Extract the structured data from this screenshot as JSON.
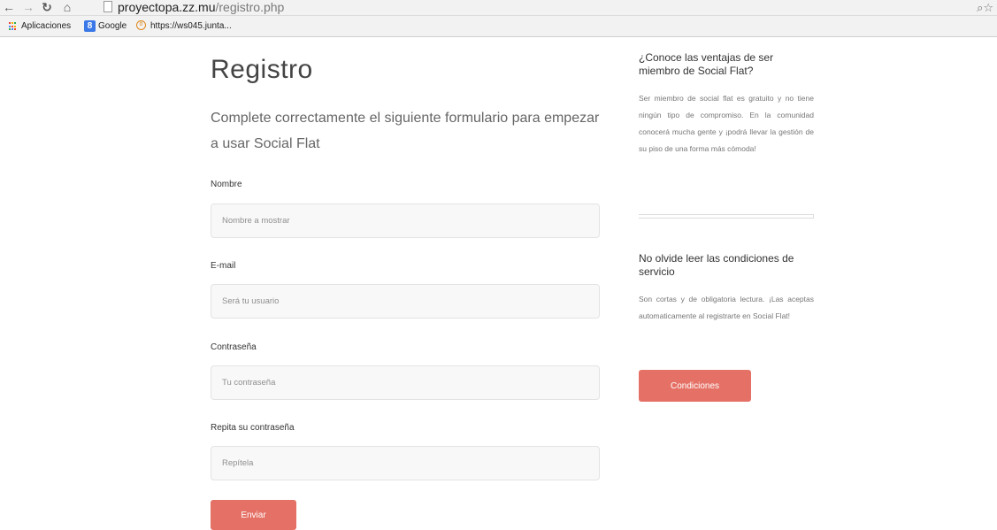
{
  "browser": {
    "url_host": "proyectopa.zz.mu",
    "url_path": "/registro.php",
    "bookmarks": [
      {
        "label": "Aplicaciones"
      },
      {
        "label": "Google"
      },
      {
        "label": "https://ws045.junta..."
      }
    ]
  },
  "form": {
    "title": "Registro",
    "subtitle": "Complete correctamente el siguiente formulario para empezar a usar Social Flat",
    "fields": [
      {
        "label": "Nombre",
        "placeholder": "Nombre a mostrar"
      },
      {
        "label": "E-mail",
        "placeholder": "Será tu usuario"
      },
      {
        "label": "Contraseña",
        "placeholder": "Tu contraseña"
      },
      {
        "label": "Repita su contraseña",
        "placeholder": "Repítela"
      }
    ],
    "submit_label": "Enviar"
  },
  "sidebar": {
    "benefits_heading": "¿Conoce las ventajas de ser miembro de Social Flat?",
    "benefits_text": "Ser miembro de social flat es gratuito y no tiene ningún tipo de compromiso. En la comunidad conocerá mucha gente y ¡podrá llevar la gestión de su piso de una forma más cómoda!",
    "terms_heading": "No olvide leer las condiciones de servicio",
    "terms_text": "Son cortas y de obligatoria lectura. ¡Las aceptas automaticamente al registrarte en Social Flat!",
    "terms_button_label": "Condiciones"
  },
  "colors": {
    "accent": "#e57166"
  }
}
